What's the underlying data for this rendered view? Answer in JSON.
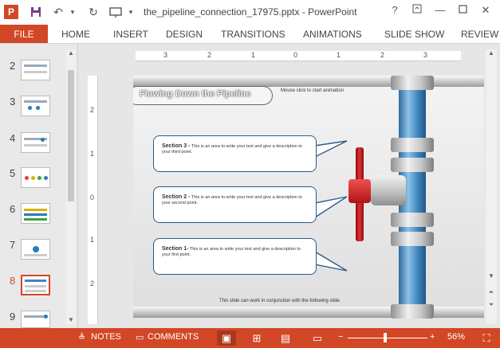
{
  "titlebar": {
    "doc_title": "the_pipeline_connection_17975.pptx - PowerPoint",
    "help": "?",
    "minimize": "—",
    "close": "✕",
    "logo": "P"
  },
  "ribbon": {
    "file": "FILE",
    "tabs": [
      "HOME",
      "INSERT",
      "DESIGN",
      "TRANSITIONS",
      "ANIMATIONS",
      "SLIDE SHOW",
      "REVIEW"
    ]
  },
  "thumbnails": {
    "numbers": [
      "2",
      "3",
      "4",
      "5",
      "6",
      "7",
      "8",
      "9"
    ],
    "active": "8"
  },
  "rulers": {
    "horizontal": [
      "3",
      "2",
      "1",
      "0",
      "1",
      "2",
      "3"
    ],
    "vertical": [
      "2",
      "1",
      "0",
      "1",
      "2"
    ]
  },
  "slide": {
    "title": "Flowing Down the Pipeline",
    "hint": "Mouse click to start animation",
    "footer": "This slide can work in conjunction with the following slide.",
    "sections": [
      {
        "heading": "Section 3 -",
        "text": "This is an area to write your text and give a description to your third point."
      },
      {
        "heading": "Section 2 -",
        "text": "This is an area to write your text and give a description to your second point."
      },
      {
        "heading": "Section 1-",
        "text": "This is an area to write your text and give a description to your first point."
      }
    ],
    "colors": {
      "pipe": "#3f86bf",
      "valve": "#e23030",
      "callout_border": "#2c5b8a"
    }
  },
  "statusbar": {
    "notes": "NOTES",
    "comments": "COMMENTS",
    "zoom_minus": "−",
    "zoom_plus": "+",
    "zoom": "56%"
  },
  "colors": {
    "accent": "#d24726"
  }
}
